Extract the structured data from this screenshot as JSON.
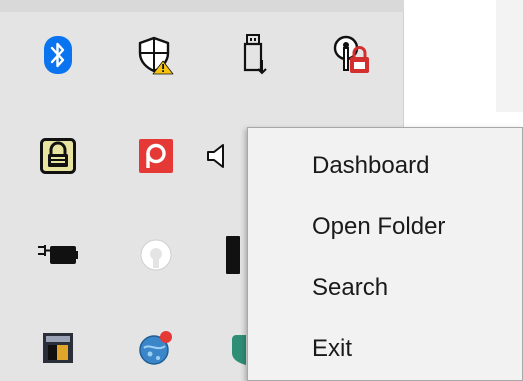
{
  "tray": {
    "icons": [
      {
        "name": "bluetooth-icon"
      },
      {
        "name": "windows-security-warning-icon"
      },
      {
        "name": "safely-remove-hardware-icon"
      },
      {
        "name": "key-lock-icon"
      },
      {
        "name": "padlock-app-icon"
      },
      {
        "name": "pushbullet-p-icon"
      },
      {
        "name": "speaker-icon"
      },
      {
        "name": "battery-charging-icon"
      },
      {
        "name": "onedrive-sync-icon"
      },
      {
        "name": "dark-app-icon"
      },
      {
        "name": "clapperboard-app-icon"
      },
      {
        "name": "globe-notification-icon"
      },
      {
        "name": "shield-app-icon"
      }
    ]
  },
  "context_menu": {
    "items": [
      {
        "label": "Dashboard"
      },
      {
        "label": "Open Folder"
      },
      {
        "label": "Search"
      },
      {
        "label": "Exit"
      }
    ]
  },
  "colors": {
    "tray_background": "#e4e4e4",
    "menu_background": "#f2f2f2",
    "bluetooth_blue": "#0a74f0",
    "pushbullet_red": "#e53935",
    "warning_yellow": "#f5c211",
    "lock_red": "#d32f2f"
  }
}
